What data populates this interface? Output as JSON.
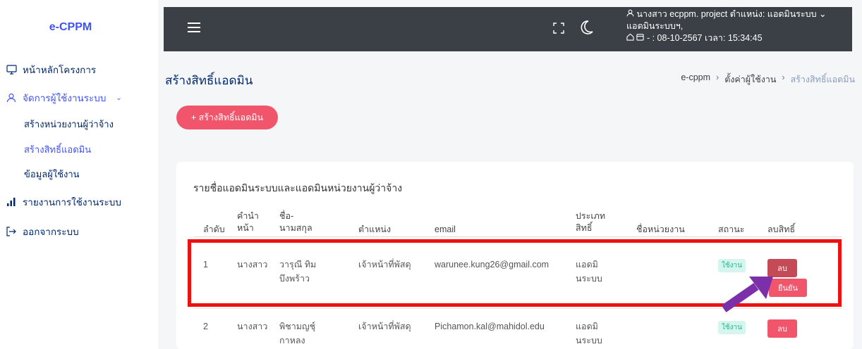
{
  "app": {
    "logo": "e-CPPM"
  },
  "sidebar": {
    "items": [
      {
        "label": "หน้าหลักโครงการ",
        "icon": "monitor-icon"
      },
      {
        "label": "จัดการผู้ใช้งานระบบ",
        "icon": "user-icon"
      },
      {
        "label": "รายงานการใช้งานระบบ",
        "icon": "chart-icon"
      },
      {
        "label": "ออกจากระบบ",
        "icon": "logout-icon"
      }
    ],
    "subitems": [
      {
        "label": "สร้างหน่วยงานผู้ว่าจ้าง"
      },
      {
        "label": "สร้างสิทธิ์แอดมิน"
      },
      {
        "label": "ข้อมูลผู้ใช้งาน"
      }
    ]
  },
  "header": {
    "user_line1": "นางสาว ecppm. project ตำแหน่ง: แอดมินระบบ",
    "user_line2": "แอดมินระบบฯ,",
    "user_line3": "- : 08-10-2567 เวลา: 15:34:45"
  },
  "page": {
    "title": "สร้างสิทธิ์แอดมิน",
    "breadcrumb": [
      "e-cppm",
      "ตั้งค่าผู้ใช้งาน",
      "สร้างสิทธิ์แอดมิน"
    ],
    "add_button": "+ สร้างสิทธิ์แอดมิน"
  },
  "table": {
    "title": "รายชื่อแอดมินระบบและแอดมินหน่วยงานผู้ว่าจ้าง",
    "headers": {
      "no": "ลำดับ",
      "prefix_1": "คำนำ",
      "prefix_2": "หน้า",
      "name_1": "ชื่อ-",
      "name_2": "นามสกุล",
      "position": "ตำแหน่ง",
      "email": "email",
      "type_1": "ประเภท",
      "type_2": "สิทธิ์",
      "unit": "ชื่อหน่วยงาน",
      "status": "สถานะ",
      "delete": "ลบสิทธิ์"
    },
    "rows": [
      {
        "no": "1",
        "prefix": "นางสาว",
        "name_1": "วารุณี ทิม",
        "name_2": "บึงพร้าว",
        "position": "เจ้าหน้าที่พัสดุ",
        "email": "warunee.kung26@gmail.com",
        "type_1": "แอดมิ",
        "type_2": "นระบบ",
        "status": "ใช้งาน",
        "delete_label": "ลบ",
        "confirm_label": "ยืนยัน"
      },
      {
        "no": "2",
        "prefix": "นางสาว",
        "name_1": "พิชามญชุ์",
        "name_2": "กาหลง",
        "position": "เจ้าหน้าที่พัสดุ",
        "email": "Pichamon.kal@mahidol.edu",
        "type_1": "แอดมิ",
        "type_2": "นระบบ",
        "status": "ใช้งาน",
        "delete_label": "ลบ"
      }
    ]
  },
  "colors": {
    "accent": "#4154f1",
    "danger": "#f1556c",
    "highlight": "#ee1111",
    "arrow": "#7b2fa8"
  }
}
